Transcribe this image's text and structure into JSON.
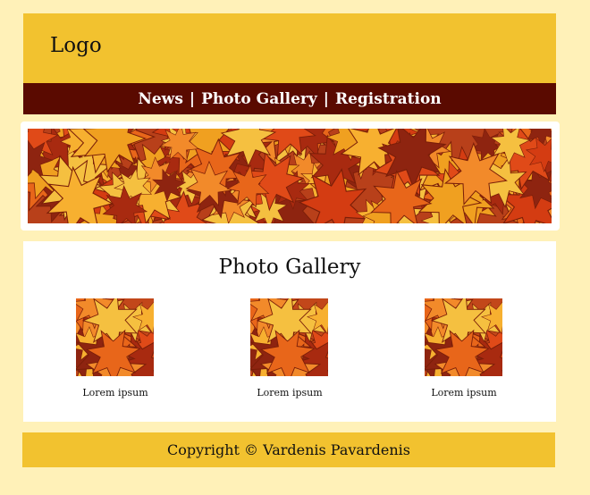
{
  "header": {
    "logo": "Logo"
  },
  "nav": {
    "items": [
      {
        "label": "News"
      },
      {
        "label": "Photo Gallery"
      },
      {
        "label": "Registration"
      }
    ],
    "separator": "|"
  },
  "banner": {
    "image": "autumn-leaves-banner"
  },
  "gallery": {
    "title": "Photo Gallery",
    "items": [
      {
        "caption": "Lorem ipsum",
        "image": "autumn-leaves-thumb"
      },
      {
        "caption": "Lorem ipsum",
        "image": "autumn-leaves-thumb"
      },
      {
        "caption": "Lorem ipsum",
        "image": "autumn-leaves-thumb"
      }
    ]
  },
  "footer": {
    "copyright": "Copyright © Vardenis Pavardenis"
  },
  "colors": {
    "page_bg": "#fff1b8",
    "header_bg": "#f2c22f",
    "nav_bg": "#5a0a00",
    "content_bg": "#ffffff"
  }
}
